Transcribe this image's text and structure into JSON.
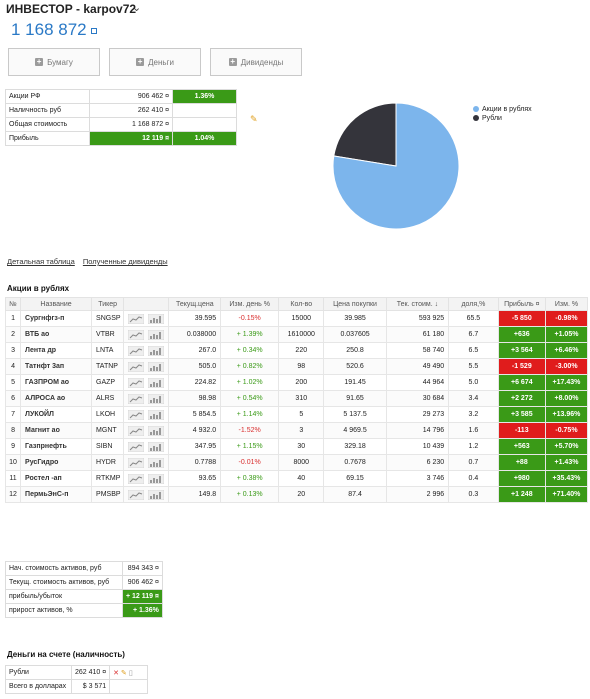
{
  "header": {
    "title": "ИНВЕСТОР - karpov72",
    "balance": "1 168 872"
  },
  "buttons": {
    "securities": "Бумагу",
    "money": "Деньги",
    "dividends": "Дивиденды"
  },
  "summary": {
    "rows": [
      {
        "label": "Акции РФ",
        "value": "906 462 ¤",
        "pct": "1.36%"
      },
      {
        "label": "Наличность руб",
        "value": "262 410 ¤",
        "pct": ""
      },
      {
        "label": "Общая стоимость",
        "value": "1 168 872 ¤",
        "pct": ""
      },
      {
        "label": "Прибыль",
        "value": "12 119 ¤",
        "pct": "1.04%"
      }
    ]
  },
  "chart_data": {
    "type": "pie",
    "labels": [
      "Акции в рублях",
      "Рубли"
    ],
    "values": [
      906462,
      262410
    ],
    "colors": [
      "#7cb5ec",
      "#34343b"
    ],
    "legend": "top-right"
  },
  "links": {
    "detail": "Детальная таблица",
    "dividends": "Полученные дивиденды"
  },
  "stocks": {
    "title": "Акции в рублях",
    "headers": [
      "№",
      "Название",
      "Тикер",
      "",
      "Текущ.цена",
      "Изм. день %",
      "Кол-во",
      "Цена покупки",
      "Тек. стоим. ↓",
      "доля,%",
      "Прибыль ¤",
      "Изм. %"
    ],
    "rows": [
      [
        "1",
        "Сургнфгз-п",
        "SNGSP",
        "39.595",
        "-0.15%",
        "15000",
        "39.985",
        "593 925",
        "65.5",
        "-5 850",
        "-0.98%"
      ],
      [
        "2",
        "ВТБ ао",
        "VTBR",
        "0.038000",
        "+ 1.39%",
        "1610000",
        "0.037605",
        "61 180",
        "6.7",
        "+636",
        "+1.05%"
      ],
      [
        "3",
        "Лента др",
        "LNTA",
        "267.0",
        "+ 0.34%",
        "220",
        "250.8",
        "58 740",
        "6.5",
        "+3 564",
        "+6.46%"
      ],
      [
        "4",
        "Татнфт 3ап",
        "TATNP",
        "505.0",
        "+ 0.82%",
        "98",
        "520.6",
        "49 490",
        "5.5",
        "-1 529",
        "-3.00%"
      ],
      [
        "5",
        "ГАЗПРОМ ао",
        "GAZP",
        "224.82",
        "+ 1.02%",
        "200",
        "191.45",
        "44 964",
        "5.0",
        "+6 674",
        "+17.43%"
      ],
      [
        "6",
        "АЛРОСА ао",
        "ALRS",
        "98.98",
        "+ 0.54%",
        "310",
        "91.65",
        "30 684",
        "3.4",
        "+2 272",
        "+8.00%"
      ],
      [
        "7",
        "ЛУКОЙЛ",
        "LKOH",
        "5 854.5",
        "+ 1.14%",
        "5",
        "5 137.5",
        "29 273",
        "3.2",
        "+3 585",
        "+13.96%"
      ],
      [
        "8",
        "Магнит ао",
        "MGNT",
        "4 932.0",
        "-1.52%",
        "3",
        "4 969.5",
        "14 796",
        "1.6",
        "-113",
        "-0.75%"
      ],
      [
        "9",
        "Газпрнефть",
        "SIBN",
        "347.95",
        "+ 1.15%",
        "30",
        "329.18",
        "10 439",
        "1.2",
        "+563",
        "+5.70%"
      ],
      [
        "10",
        "РусГидро",
        "HYDR",
        "0.7788",
        "-0.01%",
        "8000",
        "0.7678",
        "6 230",
        "0.7",
        "+88",
        "+1.43%"
      ],
      [
        "11",
        "Ростел -ап",
        "RTKMP",
        "93.65",
        "+ 0.38%",
        "40",
        "69.15",
        "3 746",
        "0.4",
        "+980",
        "+35.43%"
      ],
      [
        "12",
        "ПермьЭнС-п",
        "PMSBP",
        "149.8",
        "+ 0.13%",
        "20",
        "87.4",
        "2 996",
        "0.3",
        "+1 248",
        "+71.40%"
      ]
    ]
  },
  "totals": {
    "rows": [
      {
        "label": "Нач. стоимость активов, руб",
        "value": "894 343 ¤"
      },
      {
        "label": "Текущ. стоимость активов, руб",
        "value": "906 462 ¤"
      },
      {
        "label": "прибыль/убыток",
        "value": "+ 12 119 ¤"
      },
      {
        "label": "прирост активов, %",
        "value": "+ 1.36%"
      }
    ]
  },
  "cash": {
    "title": "Деньги на счете (наличность)",
    "rub_label": "Рубли",
    "rub_value": "262 410 ¤",
    "usd_label": "Всего в долларах",
    "usd_value": "$ 3 571"
  }
}
